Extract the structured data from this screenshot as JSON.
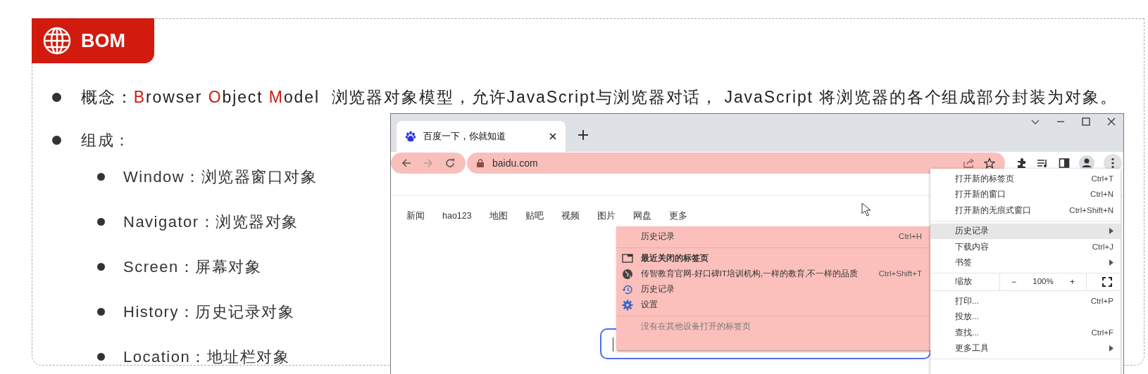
{
  "header": {
    "title": "BOM"
  },
  "concept": {
    "segments": [
      {
        "text": "概念：",
        "highlight": false
      },
      {
        "text": "B",
        "highlight": true
      },
      {
        "text": "rowser ",
        "highlight": false
      },
      {
        "text": "O",
        "highlight": true
      },
      {
        "text": "bject ",
        "highlight": false
      },
      {
        "text": "M",
        "highlight": true
      },
      {
        "text": "odel  浏览器对象模型，允许JavaScript与浏览器对话， JavaScript 将浏览器的各个组成部分封装为对象。",
        "highlight": false
      }
    ]
  },
  "composition": {
    "label": "组成：",
    "items": [
      "Window：浏览器窗口对象",
      "Navigator：浏览器对象",
      "Screen：屏幕对象",
      "History：历史记录对象",
      "Location：地址栏对象"
    ]
  },
  "browser": {
    "tab": {
      "title": "百度一下，你就知道"
    },
    "url": "baidu.com",
    "nav_links": [
      "新闻",
      "hao123",
      "地图",
      "贴吧",
      "视频",
      "图片",
      "网盘",
      "更多"
    ],
    "history_menu": {
      "groups": [
        [
          {
            "kind": "header",
            "label": "历史记录",
            "shortcut": "Ctrl+H"
          }
        ],
        [
          {
            "kind": "section",
            "label": "最近关闭的标签页"
          },
          {
            "kind": "site",
            "label": "传智教育官网-好口碑IT培训机构,一样的教育,不一样的品质",
            "shortcut": "Ctrl+Shift+T"
          },
          {
            "kind": "history",
            "label": "历史记录"
          },
          {
            "kind": "settings",
            "label": "设置"
          }
        ],
        [
          {
            "kind": "note",
            "label": "没有在其他设备打开的标签页"
          }
        ]
      ]
    },
    "main_menu": {
      "groups": [
        [
          {
            "kind": "item",
            "label": "打开新的标签页",
            "shortcut": "Ctrl+T",
            "submenu": false,
            "selected": false
          },
          {
            "kind": "item",
            "label": "打开新的窗口",
            "shortcut": "Ctrl+N",
            "submenu": false,
            "selected": false
          },
          {
            "kind": "item",
            "label": "打开新的无痕式窗口",
            "shortcut": "Ctrl+Shift+N",
            "submenu": false,
            "selected": false
          }
        ],
        [
          {
            "kind": "item",
            "label": "历史记录",
            "submenu": true,
            "selected": true
          },
          {
            "kind": "item",
            "label": "下载内容",
            "shortcut": "Ctrl+J",
            "submenu": false,
            "selected": false
          },
          {
            "kind": "item",
            "label": "书签",
            "submenu": true,
            "selected": false
          }
        ],
        [
          {
            "kind": "zoom",
            "label": "缩放",
            "minus": "−",
            "level_text": "100%",
            "plus": "+"
          }
        ],
        [
          {
            "kind": "item",
            "label": "打印...",
            "shortcut": "Ctrl+P",
            "submenu": false,
            "selected": false
          },
          {
            "kind": "item",
            "label": "投放...",
            "submenu": false,
            "selected": false
          },
          {
            "kind": "item",
            "label": "查找...",
            "shortcut": "Ctrl+F",
            "submenu": false,
            "selected": false
          },
          {
            "kind": "item",
            "label": "更多工具",
            "submenu": true,
            "selected": false
          }
        ]
      ]
    }
  }
}
